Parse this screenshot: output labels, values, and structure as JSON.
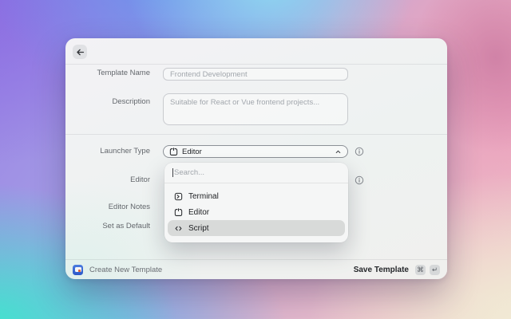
{
  "window_title": "Create New Template",
  "header": {
    "back_icon": "arrow-left"
  },
  "form": {
    "template_name": {
      "label": "Template Name",
      "placeholder": "Frontend Development"
    },
    "description": {
      "label": "Description",
      "placeholder": "Suitable for React or Vue frontend projects..."
    },
    "launcher_type": {
      "label": "Launcher Type",
      "value": "Editor",
      "icon": "editor-icon"
    },
    "editor": {
      "label": "Editor"
    },
    "editor_notes": {
      "label": "Editor Notes"
    },
    "set_as_default": {
      "label": "Set as Default"
    }
  },
  "dropdown": {
    "search_placeholder": "Search...",
    "options": [
      {
        "label": "Terminal",
        "icon": "terminal-icon",
        "selected": false
      },
      {
        "label": "Editor",
        "icon": "editor-icon",
        "selected": false
      },
      {
        "label": "Script",
        "icon": "script-icon",
        "selected": true
      }
    ]
  },
  "footer": {
    "app_name": "Create New Template",
    "primary_action": "Save Template",
    "shortcut_keys": [
      "⌘",
      "↵"
    ]
  },
  "colors": {
    "selected_option_bg": "#d8dad9",
    "app_icon_blue": "#3366cc",
    "bg_purple": "#8a6ce2",
    "bg_blue": "#6894ec",
    "bg_cyan": "#8dd5f0",
    "bg_pink": "#ea9cba",
    "bg_turquoise": "#3de6cd",
    "bg_cream": "#f1ead4"
  }
}
